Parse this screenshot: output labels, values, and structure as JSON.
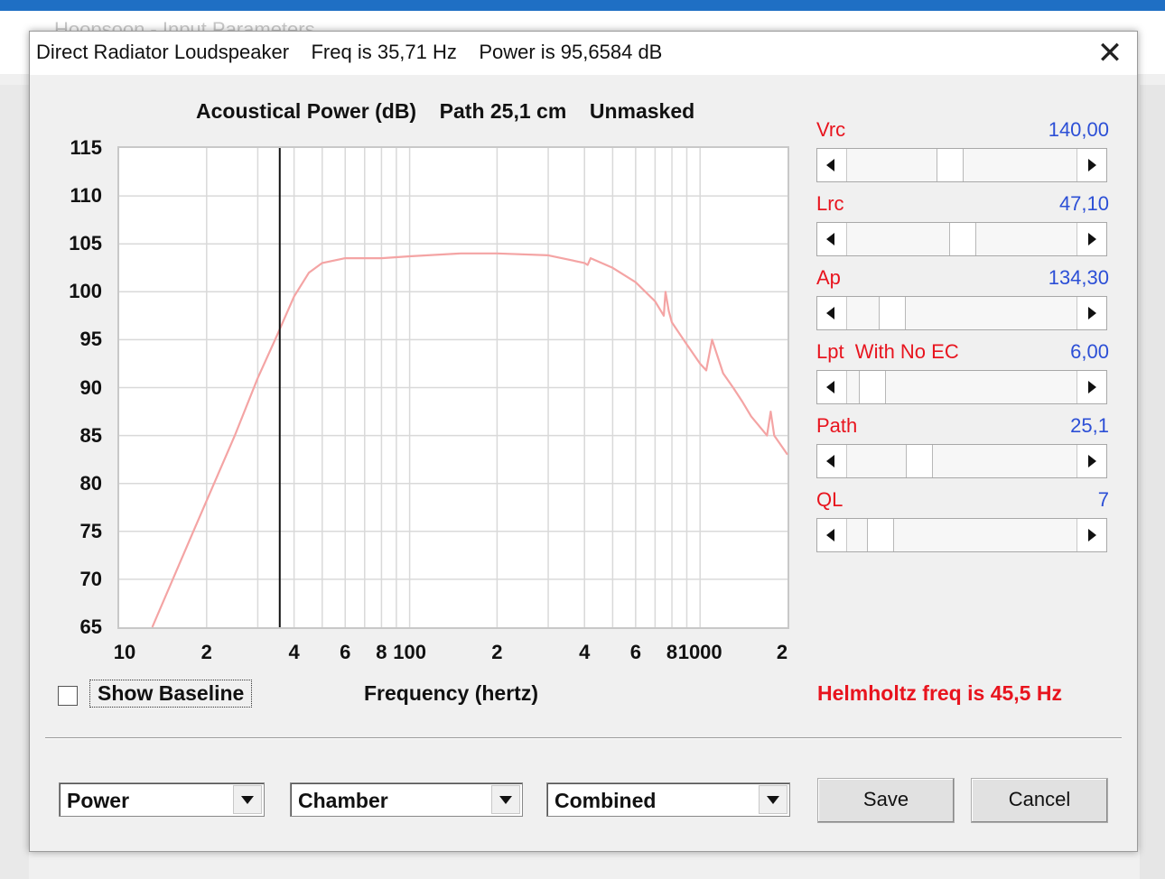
{
  "background_window": {
    "title": "Hoopsoon - Input Parameters"
  },
  "dialog": {
    "title": "Direct Radiator Loudspeaker    Freq is 35,71 Hz    Power is 95,6584 dB",
    "close_label": "✕"
  },
  "chart_header": "Acoustical Power (dB)    Path 25,1 cm    Unmasked",
  "chart_data": {
    "type": "line",
    "title": "Acoustical Power (dB)    Path 25,1 cm    Unmasked",
    "xlabel": "Frequency (hertz)",
    "ylabel": "",
    "x_scale": "log",
    "xlim": [
      10,
      2000
    ],
    "ylim": [
      65,
      115
    ],
    "y_ticks": [
      "115",
      "110",
      "105",
      "100",
      "95",
      "90",
      "85",
      "80",
      "75",
      "70",
      "65"
    ],
    "x_tick_labels": [
      "10",
      "2",
      "4",
      "6",
      "8",
      "100",
      "2",
      "4",
      "6",
      "8",
      "1000",
      "2"
    ],
    "grid": true,
    "marker_line_x": 35.71,
    "series": [
      {
        "color": "#f4a4a4",
        "x": [
          13,
          18,
          25,
          30,
          35,
          40,
          45,
          50,
          60,
          80,
          100,
          150,
          200,
          300,
          400,
          410,
          420,
          500,
          600,
          700,
          750,
          760,
          780,
          800,
          900,
          1000,
          1050,
          1100,
          1200,
          1300,
          1400,
          1500,
          1700,
          1750,
          1800,
          2000
        ],
        "y": [
          65,
          75,
          85,
          91,
          95.5,
          99.5,
          102,
          103,
          103.5,
          103.5,
          103.7,
          104,
          104,
          103.8,
          103,
          102.8,
          103.5,
          102.5,
          101,
          99,
          97.5,
          100,
          98,
          96.8,
          94.5,
          92.5,
          91.8,
          95,
          91.5,
          90,
          88.5,
          87,
          85,
          87.5,
          85,
          83
        ]
      }
    ]
  },
  "y_labels": [
    "115",
    "110",
    "105",
    "100",
    "95",
    "90",
    "85",
    "80",
    "75",
    "70",
    "65"
  ],
  "x_labels": [
    "10",
    "2",
    "4",
    "6",
    "8",
    "100",
    "2",
    "4",
    "6",
    "8",
    "1000",
    "2"
  ],
  "x_axis_label": "Frequency (hertz)",
  "show_baseline": {
    "label": "Show Baseline",
    "checked": false
  },
  "helmholtz": "Helmholtz freq is 45,5 Hz",
  "sliders": [
    {
      "label": "Vrc",
      "value": "140,00",
      "position": 0.44
    },
    {
      "label": "Lrc",
      "value": "47,10",
      "position": 0.5
    },
    {
      "label": "Ap",
      "value": "134,30",
      "position": 0.16
    },
    {
      "label": "Lpt  With No EC",
      "value": "6,00",
      "position": 0.06
    },
    {
      "label": "Path",
      "value": "25,1",
      "position": 0.29
    },
    {
      "label": "QL",
      "value": "7",
      "position": 0.1
    }
  ],
  "dropdowns": [
    {
      "value": "Power"
    },
    {
      "value": "Chamber"
    },
    {
      "value": "Combined"
    }
  ],
  "buttons": {
    "save": "Save",
    "cancel": "Cancel"
  },
  "colors": {
    "curve": "#f4a4a4",
    "accent_red": "#e8141e",
    "value_blue": "#2c4fd6"
  }
}
